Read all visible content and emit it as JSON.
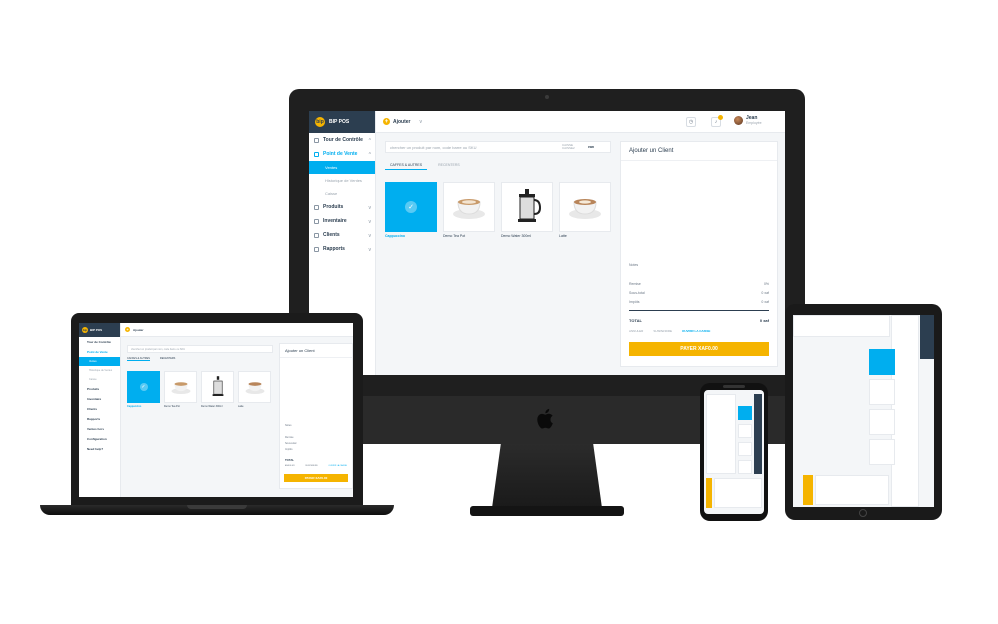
{
  "app": {
    "brand_name": "BIP POS",
    "brand_short": "bip"
  },
  "sidebar": {
    "items": [
      {
        "label": "Tour de Contrôle",
        "icon": "home-icon"
      },
      {
        "label": "Point de Vente",
        "icon": "cart-icon",
        "active": true
      },
      {
        "label": "Produits",
        "icon": "box-icon"
      },
      {
        "label": "Inventaire",
        "icon": "inventory-icon"
      },
      {
        "label": "Clients",
        "icon": "users-icon"
      },
      {
        "label": "Rapports",
        "icon": "report-icon"
      }
    ],
    "subitems": [
      {
        "label": "Ventes",
        "active": true
      },
      {
        "label": "Historique de Ventes"
      },
      {
        "label": "Caisse"
      }
    ]
  },
  "topbar": {
    "add_label": "Ajouter",
    "user_name": "Jean",
    "user_role": "Employée"
  },
  "search": {
    "placeholder": "chercher un produit par nom, code barre ou SKU",
    "type_label_1": "CAISSE",
    "type_label_2": "CAISSE2",
    "mode": "ean"
  },
  "categories": [
    {
      "label": "CAFFES & AUTRES",
      "active": true
    },
    {
      "label": "RECENTERS"
    }
  ],
  "products": [
    {
      "name": "Cappuccino",
      "selected": true,
      "kind": "cup"
    },
    {
      "name": "Demo Tea Pot",
      "kind": "cup"
    },
    {
      "name": "Demo Water 300ml",
      "kind": "press"
    },
    {
      "name": "Latte",
      "kind": "cup"
    }
  ],
  "client_panel": {
    "title": "Ajouter un Client",
    "notes_label": "Notes",
    "remise_label": "Remise",
    "remise_value": "0%",
    "subtotal_label": "Sous-total",
    "subtotal_value": "0 xaf",
    "taxes_label": "Impôts",
    "taxes_value": "0 xaf",
    "total_label": "TOTAL",
    "total_value": "0 xaf",
    "action_cancel": "ANNULER",
    "action_suspend": "SUSPENDRE",
    "action_open_drawer": "OUVRIR LA CAISSE",
    "pay_button": "PAYER XAF0.00"
  },
  "laptop": {
    "nav_extra_1": "Ventes hors",
    "nav_extra_2": "Configuration",
    "download_label": "Need help?"
  },
  "colors": {
    "accent": "#00aeef",
    "brand_dark": "#2c3e50",
    "pay": "#f5b400"
  }
}
